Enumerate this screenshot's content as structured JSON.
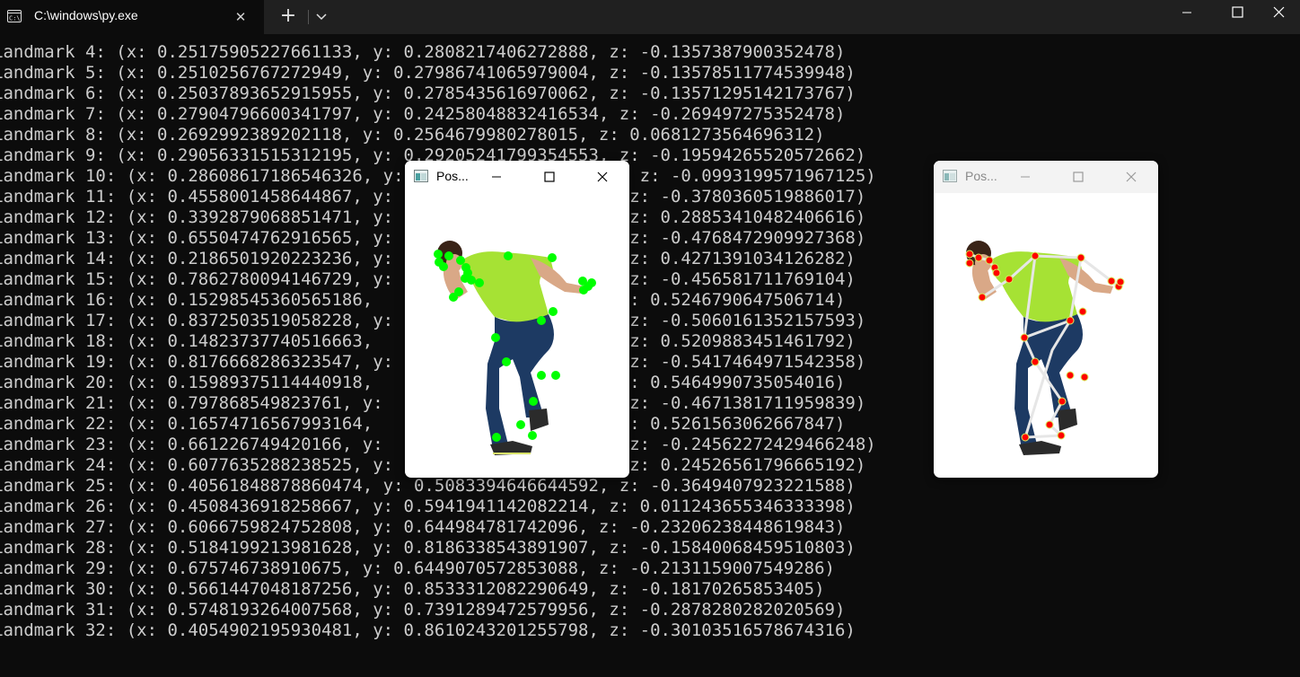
{
  "tab": {
    "title": "C:\\windows\\py.exe",
    "close_glyph": "✕",
    "new_glyph": "+"
  },
  "window_controls": {
    "minimize": "minimize-icon",
    "maximize": "maximize-icon",
    "close": "close-icon"
  },
  "terminal_lines": [
    "Landmark 4: (x: 0.25175905227661133, y: 0.2808217406272888, z: -0.1357387900352478)",
    "Landmark 5: (x: 0.2510256767272949, y: 0.27986741065979004, z: -0.13578511774539948)",
    "Landmark 6: (x: 0.25037893652915955, y: 0.2785435616970062, z: -0.13571295142173767)",
    "Landmark 7: (x: 0.27904796600341797, y: 0.24258048832416534, z: -0.269497275352478)",
    "Landmark 8: (x: 0.2692992389202118, y: 0.2564679980278015, z: 0.0681273564696312)",
    "Landmark 9: (x: 0.29056331515312195, y: 0.29205241799354553, z: -0.19594265520572662)",
    "Landmark 10: (x: 0.28608617186546326, y:                    4, z: -0.0993199571967125)",
    "Landmark 11: (x: 0.4558001458644867, y:                     , z: -0.3780360519886017)",
    "Landmark 12: (x: 0.3392879068851471, y:                     , z: 0.28853410482406616)",
    "Landmark 13: (x: 0.6550474762916565, y:                     , z: -0.4768472909927368)",
    "Landmark 14: (x: 0.2186501920223236, y:                     , z: 0.4271391034126282)",
    "Landmark 15: (x: 0.7862780094146729, y:                     , z: -0.456581711769104)",
    "Landmark 16: (x: 0.15298545360565186,                     3, z: 0.5246790647506714)",
    "Landmark 17: (x: 0.8372503519058228, y:                     , z: -0.5060161352157593)",
    "Landmark 18: (x: 0.14823737740516663,                       , z: 0.5209883451461792)",
    "Landmark 19: (x: 0.8176668286323547, y:                     , z: -0.5417464971542358)",
    "Landmark 20: (x: 0.15989375114440918,                     5, z: 0.5464990735054016)",
    "Landmark 21: (x: 0.797868549823761, y:                      , z: -0.4671381711959839)",
    "Landmark 22: (x: 0.16574716567993164,                     9, z: 0.5261563062667847)",
    "Landmark 23: (x: 0.661226749420166, y:                      , z: -0.24562272429466248)",
    "Landmark 24: (x: 0.6077635288238525, y:                     , z: 0.24526561796665192)",
    "Landmark 25: (x: 0.40561848878860474, y: 0.5083394646644592, z: -0.3649407923221588)",
    "Landmark 26: (x: 0.4508436918258667, y: 0.5941941142082214, z: 0.011243655346333398)",
    "Landmark 27: (x: 0.6066759824752808, y: 0.644984781742096, z: -0.23206238448619843)",
    "Landmark 28: (x: 0.5184199213981628, y: 0.8186338543891907, z: -0.15840068459510803)",
    "Landmark 29: (x: 0.675746738910675, y: 0.6449070572853088, z: -0.2131159007549286)",
    "Landmark 30: (x: 0.5661447048187256, y: 0.8533312082290649, z: -0.18170265853405)",
    "Landmark 31: (x: 0.5748193264007568, y: 0.7391289472579956, z: -0.2878280282020569)",
    "Landmark 32: (x: 0.4054902195930481, y: 0.8610243201255798, z: -0.30103516578674316)"
  ],
  "pose_window_1": {
    "title": "Pos...",
    "image": "person-landmarks-green"
  },
  "pose_window_2": {
    "title": "Pos...",
    "image": "person-skeleton-red"
  },
  "colors": {
    "terminal_bg": "#0c0c0c",
    "terminal_text": "#cccccc",
    "tabbar_bg": "#202020",
    "landmark_green": "#00ff00",
    "landmark_red": "#ff0000",
    "shirt": "#a6e234",
    "jeans": "#1d3a63"
  }
}
